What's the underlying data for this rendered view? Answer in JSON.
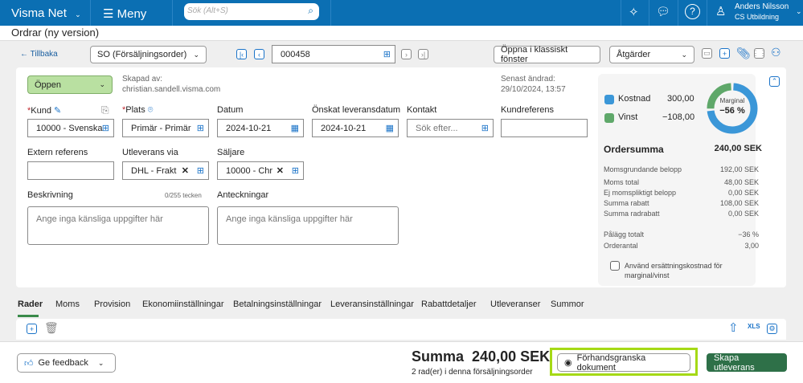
{
  "topbar": {
    "brand": "Visma Net",
    "menu": "Meny",
    "search_placeholder": "Sök (Alt+S)",
    "user_name": "Anders Nilsson",
    "user_company": "CS Utbildning"
  },
  "page_title": "Ordrar (ny version)",
  "toolbar": {
    "back": "Tillbaka",
    "order_type": "SO (Försäljningsorder)",
    "order_number": "000458",
    "open_classic": "Öppna i klassiskt fönster",
    "actions": "Åtgärder"
  },
  "header": {
    "status": "Öppen",
    "created_by_label": "Skapad av:",
    "created_by": "christian.sandell.visma.com",
    "modified_label": "Senast ändrad:",
    "modified": "29/10/2024, 13:57"
  },
  "fields": {
    "kund_label": "Kund",
    "kund": "10000 - Svenska",
    "plats_label": "Plats",
    "plats": "Primär - Primär",
    "datum_label": "Datum",
    "datum": "2024-10-21",
    "leverans_label": "Önskat leveransdatum",
    "leverans": "2024-10-21",
    "kontakt_label": "Kontakt",
    "kontakt_placeholder": "Sök efter...",
    "kundref_label": "Kundreferens",
    "extref_label": "Extern referens",
    "utlev_label": "Utleverans via",
    "utlev": "DHL - Frakt",
    "saljare_label": "Säljare",
    "saljare": "10000 - Chr",
    "beskr_label": "Beskrivning",
    "beskr_count": "0/255 tecken",
    "beskr_placeholder": "Ange inga känsliga uppgifter här",
    "antekn_label": "Anteckningar",
    "antekn_placeholder": "Ange inga känsliga uppgifter här"
  },
  "summary": {
    "kostnad_label": "Kostnad",
    "kostnad": "300,00",
    "vinst_label": "Vinst",
    "vinst": "−108,00",
    "marginal_label": "Marginal",
    "marginal": "−56 %",
    "marginal_fraction": 0.26,
    "ordersumma_label": "Ordersumma",
    "ordersumma": "240,00 SEK",
    "rows": [
      {
        "label": "Momsgrundande belopp",
        "value": "192,00 SEK"
      },
      {
        "label": "Moms total",
        "value": "48,00 SEK"
      },
      {
        "label": "Ej momspliktigt belopp",
        "value": "0,00 SEK"
      },
      {
        "label": "Summa rabatt",
        "value": "108,00 SEK"
      },
      {
        "label": "Summa radrabatt",
        "value": "0,00 SEK"
      },
      {
        "label": "Pålägg totalt",
        "value": "−36 %"
      },
      {
        "label": "Orderantal",
        "value": "3,00"
      }
    ],
    "checkbox_label": "Använd ersättningskostnad för marginal/vinst",
    "colors": {
      "kostnad": "#3b97d8",
      "vinst": "#5fa86a"
    }
  },
  "tabs": [
    "Rader",
    "Moms",
    "Provision",
    "Ekonomiinställningar",
    "Betalningsinställningar",
    "Leveransinställningar",
    "Rabattdetaljer",
    "Utleveranser",
    "Summor"
  ],
  "footer": {
    "feedback": "Ge feedback",
    "summa_label": "Summa",
    "summa": "240,00 SEK",
    "rows_info": "2 rad(er) i denna försäljningsorder",
    "preview": "Förhandsgranska dokument",
    "create": "Skapa utleverans"
  }
}
